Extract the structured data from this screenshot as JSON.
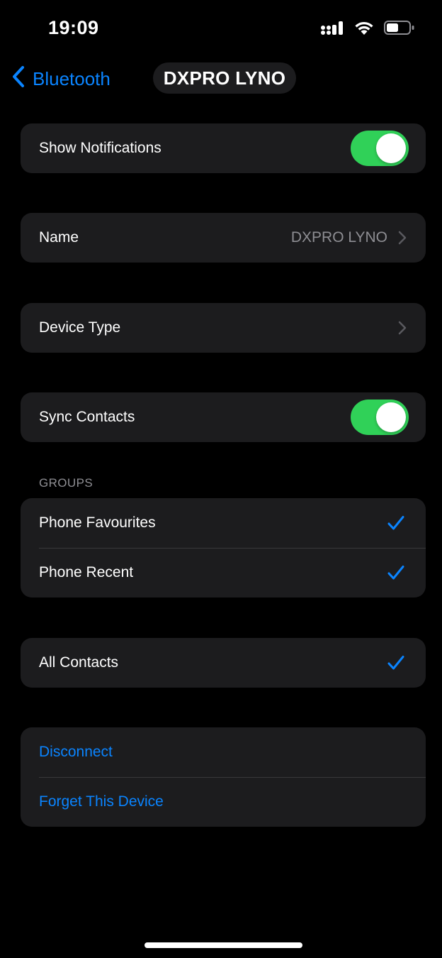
{
  "status_bar": {
    "time": "19:09",
    "icons": [
      "cellular-signal-icon",
      "wifi-icon",
      "battery-icon"
    ]
  },
  "nav": {
    "back_label": "Bluetooth",
    "title": "DXPRO LYNO"
  },
  "settings": {
    "show_notifications": {
      "label": "Show Notifications",
      "enabled": true
    },
    "name": {
      "label": "Name",
      "value": "DXPRO LYNO"
    },
    "device_type": {
      "label": "Device Type"
    },
    "sync_contacts": {
      "label": "Sync Contacts",
      "enabled": true
    }
  },
  "groups": {
    "header": "GROUPS",
    "items": [
      {
        "label": "Phone Favourites",
        "checked": true
      },
      {
        "label": "Phone Recent",
        "checked": true
      }
    ]
  },
  "all_contacts": {
    "label": "All Contacts",
    "checked": true
  },
  "actions": {
    "disconnect": "Disconnect",
    "forget": "Forget This Device"
  },
  "colors": {
    "accent": "#0a84ff",
    "toggle_on": "#30d158",
    "cell_background": "#1c1c1e",
    "secondary_text": "#8e8e93"
  }
}
